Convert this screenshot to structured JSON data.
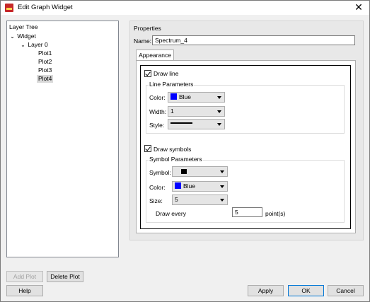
{
  "window": {
    "title": "Edit Graph Widget",
    "close_glyph": "✕"
  },
  "layer_tree": {
    "header": "Layer Tree",
    "nodes": [
      {
        "label": "Widget",
        "expanded": true
      },
      {
        "label": "Layer 0",
        "expanded": true
      },
      {
        "label": "Plot1"
      },
      {
        "label": "Plot2"
      },
      {
        "label": "Plot3"
      },
      {
        "label": "Plot4",
        "selected": true
      }
    ]
  },
  "buttons": {
    "add_plot": "Add Plot",
    "delete_plot": "Delete Plot",
    "help": "Help",
    "apply": "Apply",
    "ok": "OK",
    "cancel": "Cancel"
  },
  "properties": {
    "header": "Properties",
    "name_label": "Name:",
    "name_value": "Spectrum_4",
    "tab": "Appearance",
    "draw_line": {
      "label": "Draw line",
      "checked": true
    },
    "line_params": {
      "title": "Line Parameters",
      "color_label": "Color:",
      "color_value": "Blue",
      "color_hex": "#0000ff",
      "width_label": "Width:",
      "width_value": "1",
      "style_label": "Style:",
      "style_value": "solid-line"
    },
    "draw_symbols": {
      "label": "Draw symbols",
      "checked": true
    },
    "symbol_params": {
      "title": "Symbol Parameters",
      "symbol_label": "Symbol:",
      "symbol_value": "filled-square",
      "color_label": "Color:",
      "color_value": "Blue",
      "color_hex": "#0000ff",
      "size_label": "Size:",
      "size_value": "5",
      "draw_every_label": "Draw every",
      "draw_every_value": "5",
      "draw_every_unit": "point(s)"
    }
  },
  "icons": {
    "app": "graph-widget-app-icon",
    "close": "close-icon",
    "expand": "chevron-down-icon",
    "dropdown": "dropdown-arrow-icon"
  }
}
